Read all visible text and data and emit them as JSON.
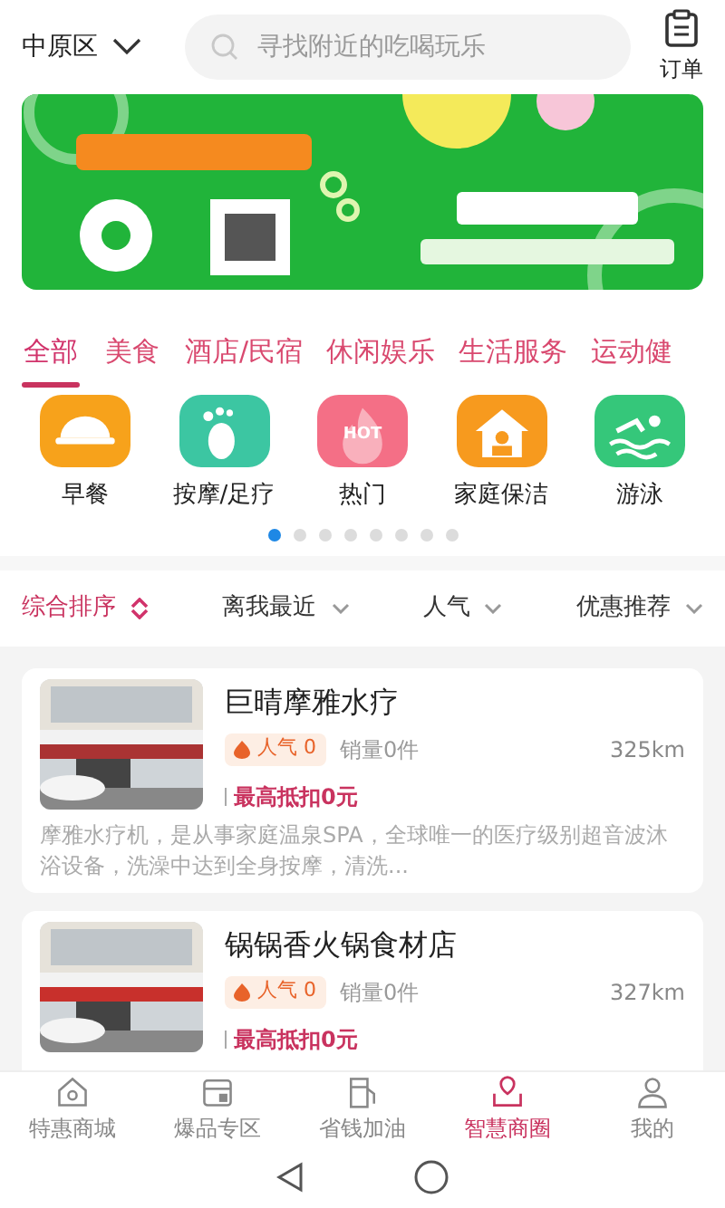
{
  "header": {
    "district": "中原区",
    "search": {
      "placeholder": "寻找附近的吃喝玩乐"
    },
    "orders_label": "订单"
  },
  "category_tabs": [
    {
      "label": "全部",
      "selected": true
    },
    {
      "label": "美食",
      "selected": false
    },
    {
      "label": "酒店/民宿",
      "selected": false
    },
    {
      "label": "休闲娱乐",
      "selected": false
    },
    {
      "label": "生活服务",
      "selected": false
    },
    {
      "label": "运动健",
      "selected": false
    }
  ],
  "shortcuts": [
    {
      "label": "早餐",
      "kind": "dome",
      "color": "#f7a21b"
    },
    {
      "label": "按摩/足疗",
      "kind": "foot",
      "color": "#3cc6a2"
    },
    {
      "label": "热门",
      "kind": "flame",
      "color": "#f46f86",
      "badge": "HOT"
    },
    {
      "label": "家庭保洁",
      "kind": "house",
      "color": "#f79a1e"
    },
    {
      "label": "游泳",
      "kind": "swim",
      "color": "#35c77a"
    }
  ],
  "shortcut_pages": [
    {
      "selected": true
    },
    {
      "selected": false
    },
    {
      "selected": false
    },
    {
      "selected": false
    },
    {
      "selected": false
    },
    {
      "selected": false
    },
    {
      "selected": false
    },
    {
      "selected": false
    }
  ],
  "sort_options": [
    {
      "label": "综合排序",
      "selected": true
    },
    {
      "label": "离我最近",
      "selected": false
    },
    {
      "label": "人气",
      "selected": false
    },
    {
      "label": "优惠推荐",
      "selected": false
    }
  ],
  "shops": [
    {
      "name": "巨晴摩雅水疗",
      "popularity": "人气 0",
      "sales": "销量0件",
      "distance": "325km",
      "discount": "最高抵扣0元",
      "description": "摩雅水疗机，是从事家庭温泉SPA，全球唯一的医疗级别超音波沐浴设备，洗澡中达到全身按摩，清洗..."
    },
    {
      "name": "锅锅香火锅食材店",
      "popularity": "人气 0",
      "sales": "销量0件",
      "distance": "327km",
      "discount": "最高抵扣0元"
    }
  ],
  "bottom_nav": [
    {
      "label": "特惠商城",
      "selected": false
    },
    {
      "label": "爆品专区",
      "selected": false
    },
    {
      "label": "省钱加油",
      "selected": false
    },
    {
      "label": "智慧商圈",
      "selected": true
    },
    {
      "label": "我的",
      "selected": false
    }
  ]
}
